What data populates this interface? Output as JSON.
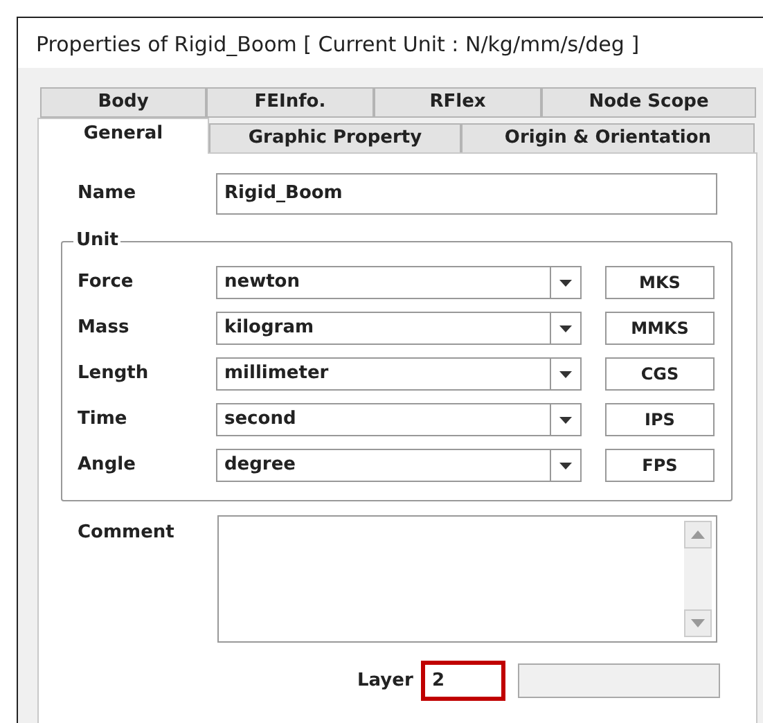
{
  "window": {
    "title": "Properties of Rigid_Boom [ Current Unit : N/kg/mm/s/deg ]"
  },
  "tab_rows": [
    [
      {
        "label": "Body",
        "selected": false
      },
      {
        "label": "FEInfo.",
        "selected": false
      },
      {
        "label": "RFlex",
        "selected": false
      },
      {
        "label": "Node Scope",
        "selected": false
      }
    ],
    [
      {
        "label": "General",
        "selected": true
      },
      {
        "label": "Graphic Property",
        "selected": false
      },
      {
        "label": "Origin & Orientation",
        "selected": false
      }
    ]
  ],
  "name": {
    "label": "Name",
    "value": "Rigid_Boom"
  },
  "unit": {
    "title": "Unit",
    "rows": [
      {
        "label": "Force",
        "value": "newton",
        "preset": "MKS"
      },
      {
        "label": "Mass",
        "value": "kilogram",
        "preset": "MMKS"
      },
      {
        "label": "Length",
        "value": "millimeter",
        "preset": "CGS"
      },
      {
        "label": "Time",
        "value": "second",
        "preset": "IPS"
      },
      {
        "label": "Angle",
        "value": "degree",
        "preset": "FPS"
      }
    ]
  },
  "comment": {
    "label": "Comment"
  },
  "layer": {
    "label": "Layer",
    "value": "2",
    "highlighted": true
  }
}
